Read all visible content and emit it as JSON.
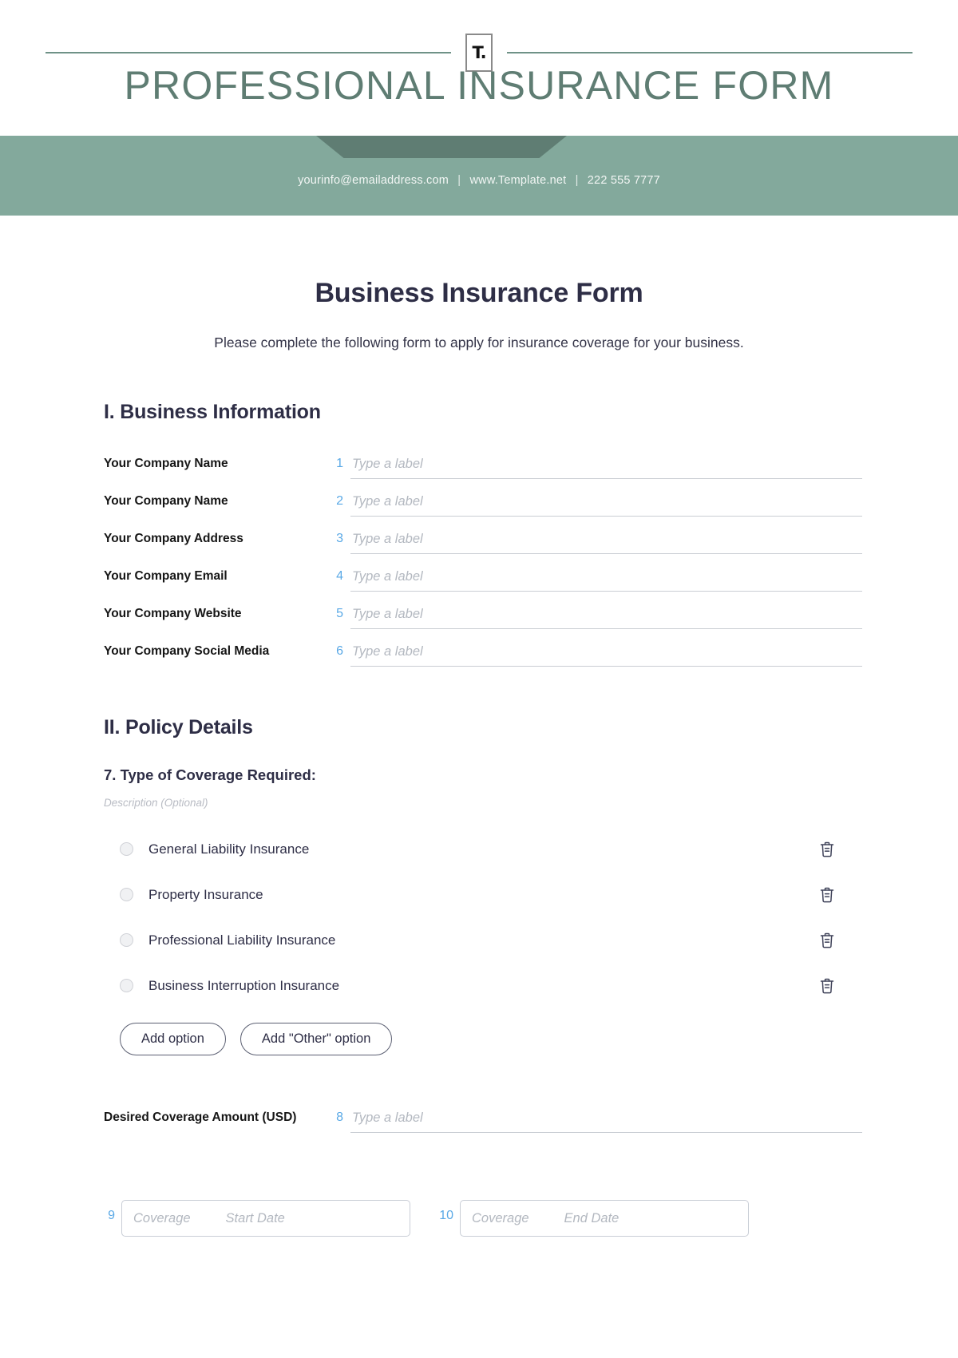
{
  "letterhead": {
    "logo_text": "T.",
    "title": "PROFESSIONAL INSURANCE FORM",
    "contact": {
      "email": "yourinfo@emailaddress.com",
      "separator": "|",
      "website": "www.Template.net",
      "phone": "222 555 7777"
    }
  },
  "document": {
    "title": "Business Insurance Form",
    "subtitle": "Please complete the following form to apply for insurance coverage for your business."
  },
  "sections": [
    {
      "heading": "I. Business Information",
      "fields": [
        {
          "number": "1",
          "label": "Your Company Name",
          "placeholder": "Type a label",
          "value": ""
        },
        {
          "number": "2",
          "label": "Your Company Name",
          "placeholder": "Type a label",
          "value": ""
        },
        {
          "number": "3",
          "label": "Your Company Address",
          "placeholder": "Type a label",
          "value": ""
        },
        {
          "number": "4",
          "label": "Your Company Email",
          "placeholder": "Type a label",
          "value": ""
        },
        {
          "number": "5",
          "label": "Your Company Website",
          "placeholder": "Type a label",
          "value": ""
        },
        {
          "number": "6",
          "label": "Your Company Social Media",
          "placeholder": "Type a label",
          "value": ""
        }
      ]
    },
    {
      "heading": "II. Policy Details",
      "question": {
        "title": "7. Type of Coverage Required:",
        "description_placeholder": "Description (Optional)",
        "options": [
          {
            "label": "General Liability Insurance",
            "selected": false,
            "delete_icon": "trash-icon"
          },
          {
            "label": "Property Insurance",
            "selected": false,
            "delete_icon": "trash-icon"
          },
          {
            "label": "Professional Liability Insurance",
            "selected": false,
            "delete_icon": "trash-icon"
          },
          {
            "label": "Business Interruption Insurance",
            "selected": false,
            "delete_icon": "trash-icon"
          }
        ],
        "buttons": {
          "add_option": "Add option",
          "add_other_option": "Add \"Other\" option"
        }
      },
      "fields": [
        {
          "number": "8",
          "label": "Desired Coverage Amount (USD)",
          "placeholder": "Type a label",
          "value": ""
        }
      ],
      "date_fields": [
        {
          "number": "9",
          "label": "Coverage",
          "placeholder": "Start Date"
        },
        {
          "number": "10",
          "label": "Coverage",
          "placeholder": "End Date"
        }
      ]
    }
  ],
  "colors": {
    "brand_green": "#83a99c",
    "brand_green_dark": "#5f7d73",
    "heading_navy": "#2e2e46",
    "accent_blue": "#5aa9e6",
    "placeholder_gray": "#b3b8c0"
  }
}
